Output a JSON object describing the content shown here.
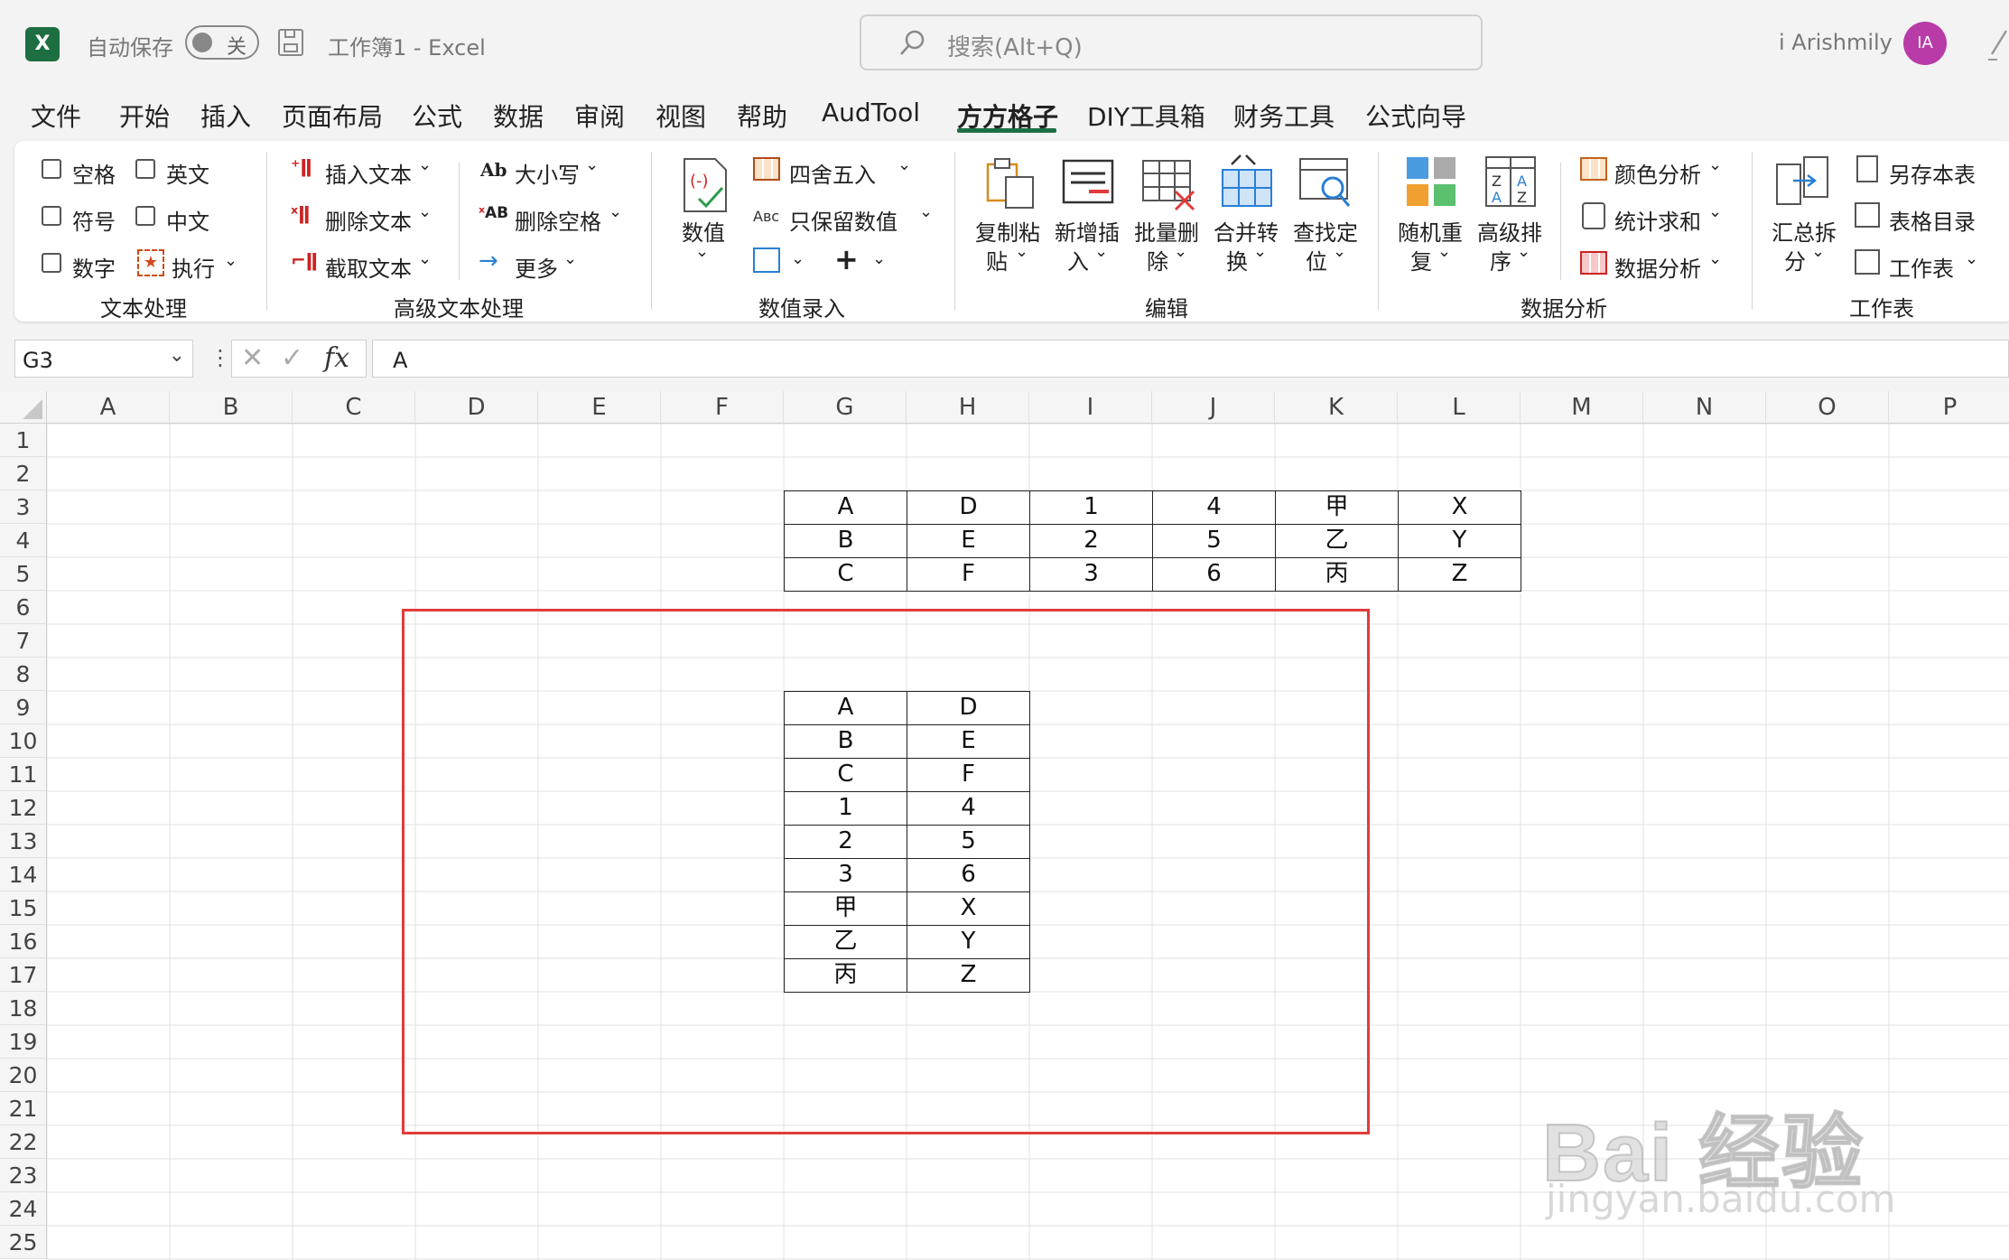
{
  "app": {
    "logo_letter": "X",
    "autosave_label": "自动保存",
    "autosave_state": "关",
    "title": "工作簿1  -  Excel",
    "search_placeholder": "搜索(Alt+Q)",
    "user_name": "i Arishmily",
    "user_initials": "IA"
  },
  "menu": [
    "文件",
    "开始",
    "插入",
    "页面布局",
    "公式",
    "数据",
    "审阅",
    "视图",
    "帮助",
    "AudTool",
    "方方格子",
    "DIY工具箱",
    "财务工具",
    "公式向导"
  ],
  "menu_active_index": 10,
  "ribbon": {
    "text_group": {
      "checks": [
        "空格",
        "英文",
        "符号",
        "中文",
        "数字"
      ],
      "execute": "执行",
      "label": "文本处理"
    },
    "adv_text_group": {
      "items": [
        "插入文本",
        "删除文本",
        "截取文本",
        "大小写",
        "删除空格",
        "更多"
      ],
      "label": "高级文本处理"
    },
    "num_group": {
      "big": "数值",
      "items": [
        "四舍五入",
        "只保留数值"
      ],
      "label": "数值录入"
    },
    "edit_group": {
      "buttons": [
        [
          "复制粘",
          "贴"
        ],
        [
          "新增插",
          "入"
        ],
        [
          "批量删",
          "除"
        ],
        [
          "合并转",
          "换"
        ],
        [
          "查找定",
          "位"
        ]
      ],
      "label": "编辑"
    },
    "analysis_group": {
      "buttons": [
        [
          "随机重",
          "复"
        ],
        [
          "高级排",
          "序"
        ]
      ],
      "items": [
        "颜色分析",
        "统计求和",
        "数据分析"
      ],
      "label": "数据分析"
    },
    "sheet_group": {
      "big": [
        "汇总拆",
        "分"
      ],
      "items": [
        "另存本表",
        "表格目录",
        "工作表"
      ],
      "label": "工作表"
    }
  },
  "formula_bar": {
    "name_box": "G3",
    "fx": "fx",
    "value": "A"
  },
  "sheet": {
    "columns": [
      "A",
      "B",
      "C",
      "D",
      "E",
      "F",
      "G",
      "H",
      "I",
      "J",
      "K",
      "L",
      "M",
      "N",
      "O",
      "P"
    ],
    "rows": [
      "1",
      "2",
      "3",
      "4",
      "5",
      "6",
      "7",
      "8",
      "9",
      "10",
      "11",
      "12",
      "13",
      "14",
      "15",
      "16",
      "17",
      "18",
      "19",
      "20",
      "21",
      "22",
      "23",
      "24",
      "25"
    ],
    "table1": [
      [
        "A",
        "D",
        "1",
        "4",
        "甲",
        "X"
      ],
      [
        "B",
        "E",
        "2",
        "5",
        "乙",
        "Y"
      ],
      [
        "C",
        "F",
        "3",
        "6",
        "丙",
        "Z"
      ]
    ],
    "table2": [
      [
        "A",
        "D"
      ],
      [
        "B",
        "E"
      ],
      [
        "C",
        "F"
      ],
      [
        "1",
        "4"
      ],
      [
        "2",
        "5"
      ],
      [
        "3",
        "6"
      ],
      [
        "甲",
        "X"
      ],
      [
        "乙",
        "Y"
      ],
      [
        "丙",
        "Z"
      ]
    ]
  },
  "watermark": {
    "line1": "Bai 经验",
    "line2": "jingyan.baidu.com"
  },
  "colors": {
    "excel_green": "#1d6f42",
    "highlight_red": "#e23b3b",
    "avatar": "#b83ba8"
  }
}
